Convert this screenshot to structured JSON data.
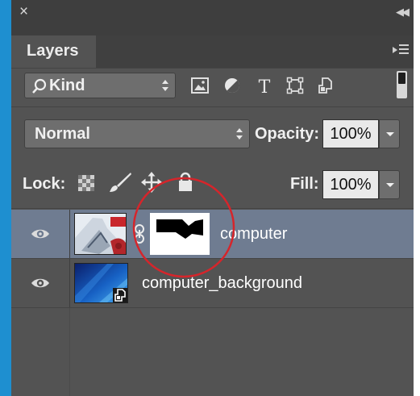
{
  "panel": {
    "tab_label": "Layers",
    "filter": {
      "selected": "Kind",
      "icons": [
        "image-filter-icon",
        "adjustment-filter-icon",
        "type-filter-icon",
        "shape-filter-icon",
        "smart-object-filter-icon"
      ]
    },
    "blend_mode": "Normal",
    "opacity": {
      "label": "Opacity:",
      "value": "100%"
    },
    "lock": {
      "label": "Lock:",
      "icons": [
        "lock-transparent-pixels-icon",
        "lock-image-pixels-icon",
        "lock-position-icon",
        "lock-all-icon"
      ]
    },
    "fill": {
      "label": "Fill:",
      "value": "100%"
    }
  },
  "layers": [
    {
      "name": "computer",
      "selected": true,
      "visible": true,
      "has_mask": true
    },
    {
      "name": "computer_background",
      "selected": false,
      "visible": true,
      "smart_object": true
    }
  ],
  "colors": {
    "panel_bg": "#535353",
    "selected_row": "#6f7c91",
    "annotation": "#d6252b",
    "window_edge": "#1e8fd0"
  }
}
